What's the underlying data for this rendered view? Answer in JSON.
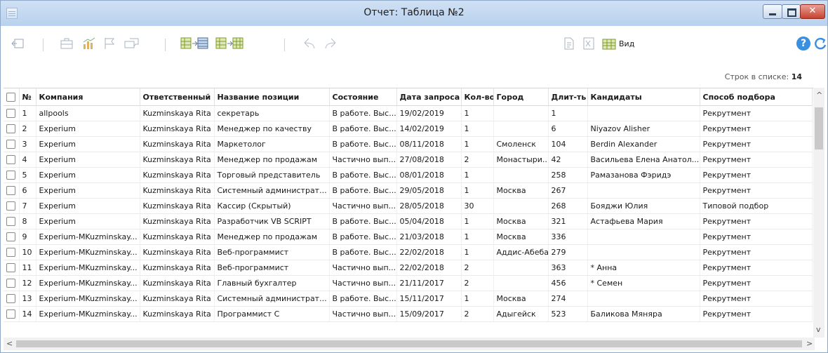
{
  "window": {
    "title": "Отчет: Таблица №2",
    "close_glyph": "✕",
    "close_color": "#c7432f",
    "icons": [
      "app-icon",
      "minimize-icon",
      "maximize-icon",
      "close-icon"
    ]
  },
  "toolbar": {
    "view_label": "Вид",
    "help_glyph": "?",
    "accent_color": "#3a8fe0",
    "icons": [
      "back-icon",
      "briefcase-icon",
      "chart-icon",
      "flag-icon",
      "comment-icon",
      "columns-to-list-icon",
      "columns-to-grid-icon",
      "undo-icon",
      "redo-icon",
      "document-icon",
      "excel-icon",
      "view-icon",
      "help-icon",
      "refresh-icon"
    ]
  },
  "summary": {
    "label": "Строк в списке:",
    "count": "14"
  },
  "table": {
    "columns": [
      "№",
      "Компания",
      "Ответственный",
      "Название позиции",
      "Состояние",
      "Дата запроса",
      "Кол-во",
      "Город",
      "Длит-ть",
      "Кандидаты",
      "Способ подбора"
    ],
    "rows": [
      [
        "1",
        "allpools",
        "Kuzminskaya Rita",
        "секретарь",
        "В работе. Выс...",
        "19/02/2019",
        "1",
        "",
        "1",
        "",
        "Рекрутмент"
      ],
      [
        "2",
        "Experium",
        "Kuzminskaya Rita",
        "Менеджер по качеству",
        "В работе. Выс...",
        "14/02/2019",
        "1",
        "",
        "6",
        "Niyazov Alisher",
        "Рекрутмент"
      ],
      [
        "3",
        "Experium",
        "Kuzminskaya Rita",
        "Маркетолог",
        "В работе. Выс...",
        "08/11/2018",
        "1",
        "Смоленск",
        "104",
        "Berdin Alexander",
        "Рекрутмент"
      ],
      [
        "4",
        "Experium",
        "Kuzminskaya Rita",
        "Менеджер по продажам",
        "Частично вып...",
        "27/08/2018",
        "2",
        "Монастыри...",
        "42",
        "Васильева Елена Анатол...",
        "Рекрутмент"
      ],
      [
        "5",
        "Experium",
        "Kuzminskaya Rita",
        "Торговый представитель",
        "В работе. Выс...",
        "08/01/2018",
        "1",
        "",
        "258",
        "Рамазанова Фэридэ",
        "Рекрутмент"
      ],
      [
        "6",
        "Experium",
        "Kuzminskaya Rita",
        "Системный администрат...",
        "В работе. Выс...",
        "29/05/2018",
        "1",
        "Москва",
        "267",
        "",
        "Рекрутмент"
      ],
      [
        "7",
        "Experium",
        "Kuzminskaya Rita",
        "Кассир (Скрытый)",
        "Частично вып...",
        "28/05/2018",
        "30",
        "",
        "268",
        "Бояджи Юлия",
        "Типовой подбор"
      ],
      [
        "8",
        "Experium",
        "Kuzminskaya Rita",
        "Разработчик VB SCRIPT",
        "В работе. Выс...",
        "05/04/2018",
        "1",
        "Москва",
        "321",
        "Астафьева Мария",
        "Рекрутмент"
      ],
      [
        "9",
        "Experium-MKuzminskay...",
        "Kuzminskaya Rita",
        "Менеджер по продажам",
        "В работе. Выс...",
        "21/03/2018",
        "1",
        "Москва",
        "336",
        "",
        "Рекрутмент"
      ],
      [
        "10",
        "Experium-MKuzminskay...",
        "Kuzminskaya Rita",
        "Веб-программист",
        "В работе. Выс...",
        "22/02/2018",
        "1",
        "Аддис-Абеба",
        "279",
        "",
        "Рекрутмент"
      ],
      [
        "11",
        "Experium-MKuzminskay...",
        "Kuzminskaya Rita",
        "Веб-программист",
        "Частично вып...",
        "22/02/2018",
        "2",
        "",
        "363",
        "* Анна",
        "Рекрутмент"
      ],
      [
        "12",
        "Experium-MKuzminskay...",
        "Kuzminskaya Rita",
        "Главный бухгалтер",
        "Частично вып...",
        "21/11/2017",
        "2",
        "",
        "456",
        "* Семен",
        "Рекрутмент"
      ],
      [
        "13",
        "Experium-MKuzminskay...",
        "Kuzminskaya Rita",
        "Системный администрат...",
        "В работе. Выс...",
        "15/11/2017",
        "1",
        "Москва",
        "274",
        "",
        "Рекрутмент"
      ],
      [
        "14",
        "Experium-MKuzminskay...",
        "Kuzminskaya Rita",
        "Программист С",
        "Частично вып...",
        "15/09/2017",
        "2",
        "Адыгейск",
        "523",
        "Баликова Мяняра",
        "Рекрутмент"
      ]
    ]
  },
  "scrollbars": {
    "up": "^",
    "down": "v",
    "left": "<",
    "right": ">"
  }
}
